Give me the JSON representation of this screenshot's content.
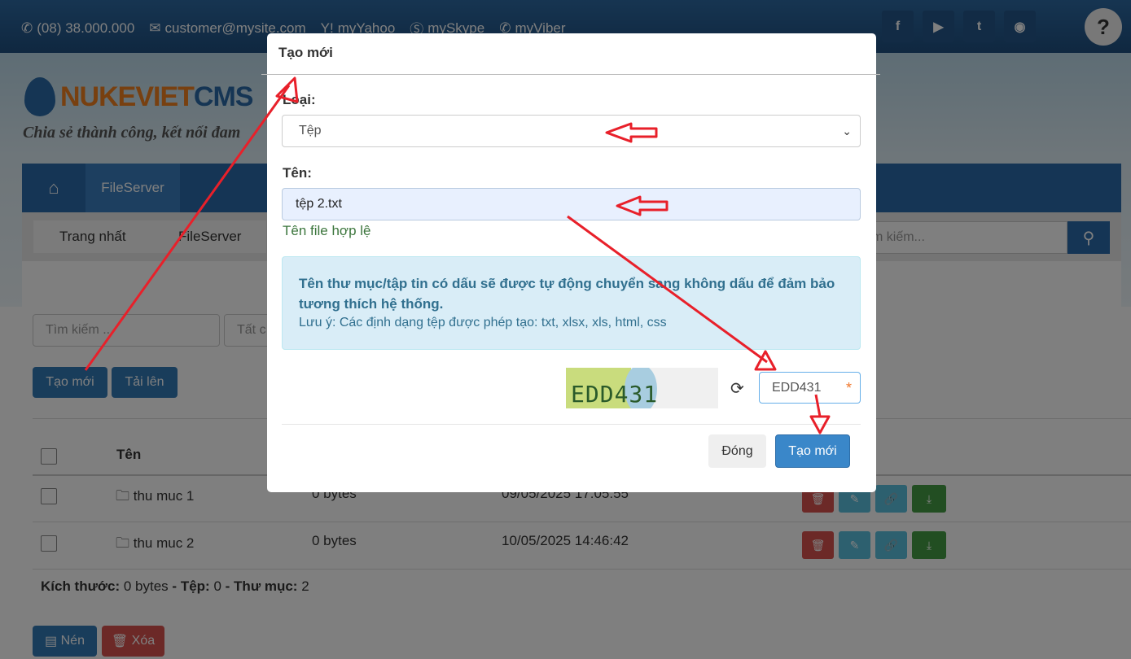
{
  "topbar": {
    "phone": "(08) 38.000.000",
    "email": "customer@mysite.com",
    "yahoo": "myYahoo",
    "skype": "mySkype",
    "viber": "myViber",
    "social_icons": [
      "facebook-icon",
      "youtube-icon",
      "twitter-icon",
      "rss-icon"
    ]
  },
  "header": {
    "logo_part1": "NUKEVIET",
    "logo_part2": "CMS",
    "slogan": "Chia sẻ thành công, kết nối đam"
  },
  "nav": {
    "fileserver": "FileServer"
  },
  "breadcrumb": {
    "home": "Trang nhất",
    "current": "FileServer"
  },
  "site_search": {
    "placeholder": "m kiếm..."
  },
  "filters": {
    "search_placeholder": "Tìm kiếm ...",
    "type_select": "Tất c"
  },
  "toolbar": {
    "create_label": "Tạo mới",
    "upload_label": "Tải lên"
  },
  "table": {
    "header_name": "Tên",
    "rows": [
      {
        "name": "thu muc 1",
        "size": "0 bytes",
        "date": "09/05/2025 17:05:55"
      },
      {
        "name": "thu muc 2",
        "size": "0 bytes",
        "date": "10/05/2025 14:46:42"
      }
    ]
  },
  "summary": {
    "size_label": "Kích thước:",
    "size_value": "0 bytes",
    "sep1": "-",
    "files_label": "Tệp:",
    "files_value": "0",
    "sep2": "-",
    "folders_label": "Thư mục:",
    "folders_value": "2"
  },
  "bottom_actions": {
    "compress_label": "Nén",
    "delete_label": "Xóa"
  },
  "modal": {
    "title": "Tạo mới",
    "type_label": "Loại:",
    "type_value": "Tệp",
    "name_label": "Tên:",
    "name_value": "tệp 2.txt",
    "valid_msg": "Tên file hợp lệ",
    "info_line": "Tên thư mục/tập tin có dấu sẽ được tự động chuyển sang không dấu để đảm bảo tương thích hệ thống.",
    "info_note": "Lưu ý: Các định dạng tệp được phép tạo: txt, xlsx, xls, html, css",
    "captcha_code": "EDD431",
    "captcha_input": "EDD431",
    "required_mark": "*",
    "close_label": "Đóng",
    "create_label": "Tạo mới"
  },
  "colors": {
    "primary": "#337ab7",
    "danger": "#d9534f",
    "info": "#5bc0de",
    "success": "#449d44",
    "annotation": "#e8202a"
  }
}
